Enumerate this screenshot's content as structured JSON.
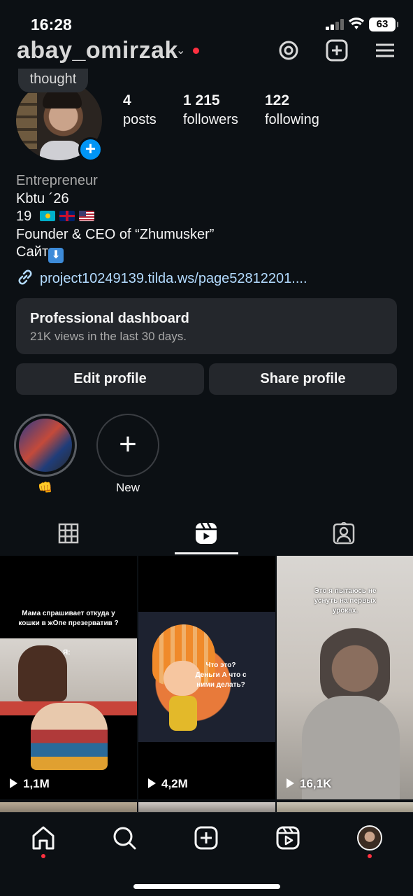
{
  "status_bar": {
    "time": "16:28",
    "battery": "63"
  },
  "profile": {
    "username": "abay_omirzak",
    "thought": "thought",
    "stats": [
      {
        "value": "4",
        "label": "posts"
      },
      {
        "value": "1 215",
        "label": "followers"
      },
      {
        "value": "122",
        "label": "following"
      }
    ],
    "bio": {
      "category": "Entrepreneur",
      "line1": "Kbtu ´26",
      "line2_prefix": "19",
      "line3": "Founder & CEO of “Zhumusker”",
      "line4": "Сайт"
    },
    "link": "project10249139.tilda.ws/page52812201...."
  },
  "dashboard": {
    "title": "Professional dashboard",
    "subtitle": "21K views in the last 30 days."
  },
  "buttons": {
    "edit": "Edit profile",
    "share": "Share profile"
  },
  "highlights": [
    {
      "label": "👊"
    },
    {
      "label": "New"
    }
  ],
  "grid": [
    {
      "views": "1,1M",
      "caption": "Мама спрашивает откуда у кошки в жОпе презерватив ?",
      "caption2": "Я:"
    },
    {
      "views": "4,2M",
      "caption": "Что это? Деньги А что с ними делать?"
    },
    {
      "views": "16,1K",
      "caption": "Это я пытаюсь не уснуть на первых уроках."
    }
  ],
  "colors": {
    "accent": "#0095f6",
    "background": "#0c1014",
    "card": "#24272c",
    "notification": "#ff3040",
    "link": "#b3dbff"
  }
}
